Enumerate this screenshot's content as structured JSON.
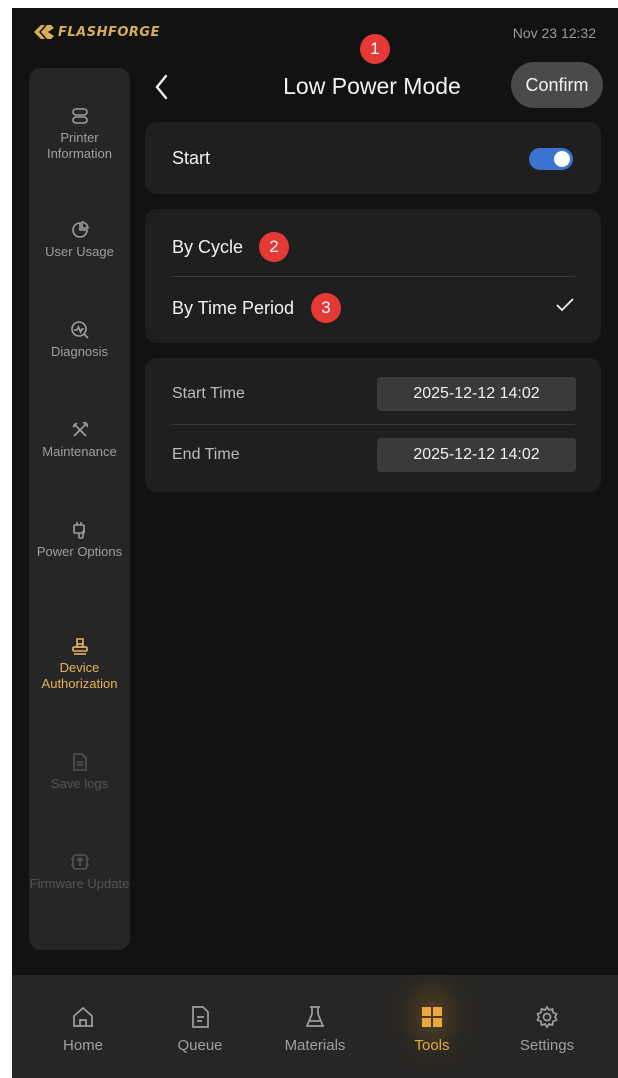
{
  "status_bar": {
    "brand": "FLASHFORGE",
    "datetime": "Nov 23  12:32"
  },
  "header": {
    "title": "Low Power Mode",
    "confirm_label": "Confirm",
    "back_icon": "chevron-left-icon"
  },
  "sidebar": {
    "items": [
      {
        "label": "Printer Information",
        "icon": "printer-icon",
        "state": "normal"
      },
      {
        "label": "User Usage",
        "icon": "pie-chart-icon",
        "state": "normal"
      },
      {
        "label": "Diagnosis",
        "icon": "diagnosis-icon",
        "state": "normal"
      },
      {
        "label": "Maintenance",
        "icon": "tools-icon",
        "state": "normal"
      },
      {
        "label": "Power Options",
        "icon": "plug-icon",
        "state": "normal"
      },
      {
        "label": "Device Authorization",
        "icon": "stamp-icon",
        "state": "active"
      },
      {
        "label": "Save logs",
        "icon": "document-icon",
        "state": "disabled"
      },
      {
        "label": "Firmware Update",
        "icon": "firmware-icon",
        "state": "disabled"
      }
    ]
  },
  "start_card": {
    "label": "Start",
    "toggle_on": true
  },
  "mode_card": {
    "options": [
      {
        "label": "By Cycle",
        "selected": false
      },
      {
        "label": "By Time Period",
        "selected": true
      }
    ]
  },
  "time_card": {
    "start_time_label": "Start Time",
    "start_time_value": "2025-12-12  14:02",
    "end_time_label": "End Time",
    "end_time_value": "2025-12-12  14:02"
  },
  "annotations": [
    "1",
    "2",
    "3"
  ],
  "bottom_nav": {
    "items": [
      {
        "label": "Home",
        "icon": "home-icon",
        "active": false
      },
      {
        "label": "Queue",
        "icon": "queue-icon",
        "active": false
      },
      {
        "label": "Materials",
        "icon": "flask-icon",
        "active": false
      },
      {
        "label": "Tools",
        "icon": "tools-grid-icon",
        "active": true
      },
      {
        "label": "Settings",
        "icon": "gear-icon",
        "active": false
      }
    ]
  },
  "colors": {
    "background": "#121212",
    "panel": "#262626",
    "card": "#1f1f1f",
    "accent": "#e8b45a",
    "toggle": "#3b73d1",
    "badge": "#e53935"
  }
}
